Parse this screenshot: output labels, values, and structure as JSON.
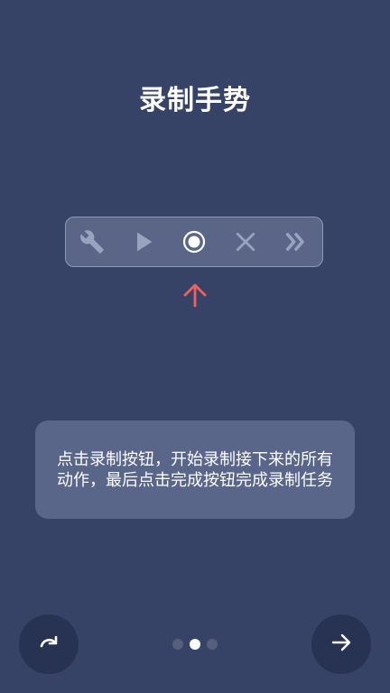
{
  "title": "录制手势",
  "toolbar": {
    "tools": [
      {
        "icon": "wrench-icon",
        "active": false
      },
      {
        "icon": "play-icon",
        "active": false
      },
      {
        "icon": "record-icon",
        "active": true
      },
      {
        "icon": "close-icon",
        "active": false
      },
      {
        "icon": "fast-forward-icon",
        "active": false
      }
    ]
  },
  "pointer": {
    "icon": "arrow-up-icon",
    "color": "#f25f5f"
  },
  "tip": {
    "text": "点击录制按钮，开始录制接下来的所有动作，最后点击完成按钮完成录制任务"
  },
  "navigation": {
    "skip_icon": "redo-icon",
    "next_icon": "arrow-right-icon",
    "pages_total": 3,
    "current_page": 2
  },
  "colors": {
    "background": "#364266",
    "toolbar": "#5a6587",
    "tip_card": "#596589",
    "round_button": "#283252",
    "pointer": "#f25f5f"
  }
}
